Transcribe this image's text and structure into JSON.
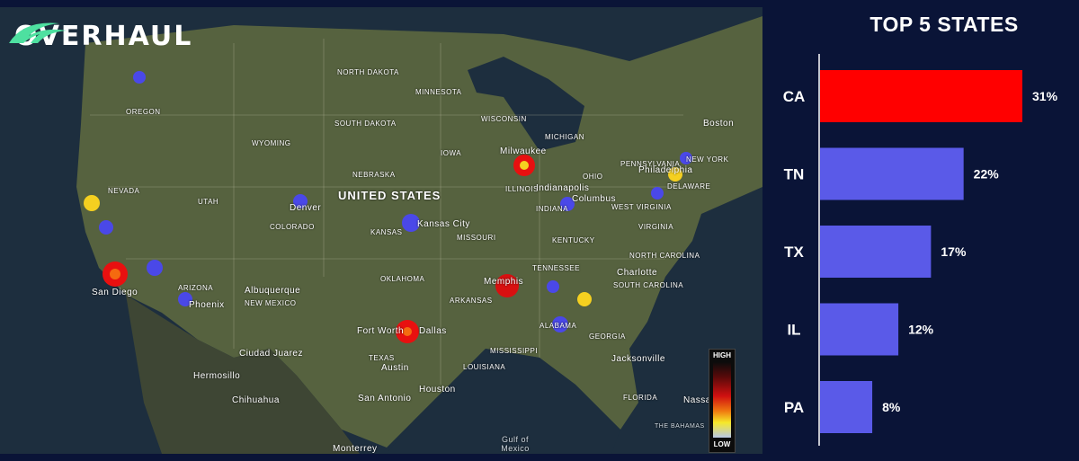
{
  "brand": {
    "name": "OVERHAUL",
    "icon": "swoosh-logo-icon",
    "accent": "#4ee0a0"
  },
  "map": {
    "country": "UNITED STATES",
    "states": [
      "NORTH DAKOTA",
      "MINNESOTA",
      "SOUTH DAKOTA",
      "WISCONSIN",
      "IOWA",
      "NEBRASKA",
      "WYOMING",
      "COLORADO",
      "KANSAS",
      "MISSOURI",
      "ILLINOIS",
      "INDIANA",
      "OHIO",
      "PENNSYLVANIA",
      "MICHIGAN",
      "KENTUCKY",
      "TENNESSEE",
      "ARKANSAS",
      "OKLAHOMA",
      "TEXAS",
      "NEW MEXICO",
      "ARIZONA",
      "UTAH",
      "NEVADA",
      "OREGON",
      "MISSISSIPPI",
      "ALABAMA",
      "GEORGIA",
      "LOUISIANA",
      "FLORIDA",
      "VIRGINIA",
      "WEST VIRGINIA",
      "NORTH CAROLINA",
      "SOUTH CAROLINA",
      "NEW YORK",
      "DELAWARE"
    ],
    "cities": [
      "Denver",
      "Kansas City",
      "Indianapolis",
      "Columbus",
      "Milwaukee",
      "Memphis",
      "Fort Worth",
      "Dallas",
      "Austin",
      "San Antonio",
      "Houston",
      "Albuquerque",
      "Phoenix",
      "San Diego",
      "Charlotte",
      "Jacksonville",
      "Philadelphia",
      "Boston",
      "Hermosillo",
      "Chihuahua",
      "Monterrey",
      "Ciudad Juarez",
      "Nassau"
    ],
    "water": [
      "Gulf of Mexico",
      "THE BAHAMAS"
    ],
    "legend": {
      "high": "HIGH",
      "low": "LOW"
    },
    "heat_colors": {
      "high": "#e01010",
      "mid": "#f5d020",
      "low": "#4a48e8"
    }
  },
  "chart_data": {
    "type": "bar",
    "orientation": "horizontal",
    "title": "TOP 5 STATES",
    "categories": [
      "CA",
      "TN",
      "TX",
      "IL",
      "PA"
    ],
    "values": [
      31,
      22,
      17,
      12,
      8
    ],
    "value_labels": [
      "31%",
      "22%",
      "17%",
      "12%",
      "8%"
    ],
    "unit": "%",
    "xlim": [
      0,
      31
    ],
    "colors": [
      "#ff0000",
      "#5a5ae8",
      "#5a5ae8",
      "#5a5ae8",
      "#5a5ae8"
    ],
    "grid": false,
    "legend": "none"
  }
}
